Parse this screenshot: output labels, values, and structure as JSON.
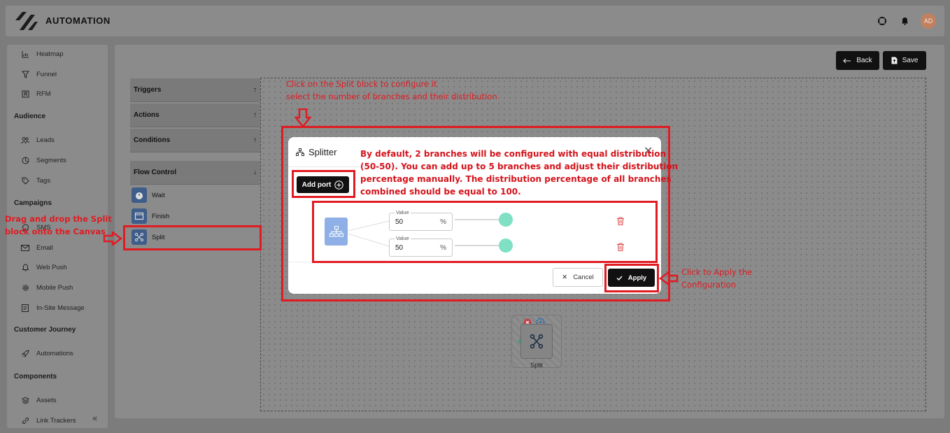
{
  "app": {
    "title": "AUTOMATION",
    "avatar_initials": "AD"
  },
  "sidebar": {
    "sections": [
      {
        "label": "Audience"
      },
      {
        "label": "Campaigns"
      },
      {
        "label": "Customer Journey"
      },
      {
        "label": "Components"
      }
    ],
    "items": [
      {
        "label": "Heatmap",
        "icon": "chart-icon"
      },
      {
        "label": "Funnel",
        "icon": "funnel-icon"
      },
      {
        "label": "RFM",
        "icon": "rfm-icon"
      },
      {
        "label": "Leads",
        "icon": "users-icon"
      },
      {
        "label": "Segments",
        "icon": "pie-icon"
      },
      {
        "label": "Tags",
        "icon": "tag-icon"
      },
      {
        "label": "SMS",
        "icon": "sms-icon"
      },
      {
        "label": "Email",
        "icon": "mail-icon"
      },
      {
        "label": "Web Push",
        "icon": "bell-icon"
      },
      {
        "label": "Mobile Push",
        "icon": "gear-icon"
      },
      {
        "label": "In-Site Message",
        "icon": "message-icon"
      },
      {
        "label": "Automations",
        "icon": "rocket-icon"
      },
      {
        "label": "Assets",
        "icon": "stack-icon"
      },
      {
        "label": "Link Trackers",
        "icon": "link-icon"
      }
    ],
    "collapse_glyph": "«"
  },
  "toolbar": {
    "back_label": "Back",
    "save_label": "Save"
  },
  "palette": {
    "groups": [
      {
        "label": "Triggers",
        "arrow": "↑"
      },
      {
        "label": "Actions",
        "arrow": "↑"
      },
      {
        "label": "Conditions",
        "arrow": "↑"
      },
      {
        "label": "Flow Control",
        "arrow": "↓"
      }
    ],
    "flow_items": [
      {
        "label": "Wait"
      },
      {
        "label": "Finish"
      },
      {
        "label": "Split"
      }
    ]
  },
  "canvas": {
    "node_label": "Split"
  },
  "modal": {
    "title": "Splitter",
    "close_glyph": "✕",
    "add_port_label": "Add port",
    "branches": [
      {
        "field_label": "Value",
        "value": "50",
        "unit": "%",
        "slider_fraction": 1.0
      },
      {
        "field_label": "Value",
        "value": "50",
        "unit": "%",
        "slider_fraction": 1.0
      }
    ],
    "cancel_label": "Cancel",
    "apply_label": "Apply"
  },
  "annotations": {
    "top_line1": "Click on the Split block to configure it",
    "top_line2": "select the number of branches and their distribution",
    "defaults_l1": "By default, 2 branches will be configured with equal distribution",
    "defaults_l2": "(50-50). You can add up to 5 branches and adjust their distribution",
    "defaults_l3": "percentage manually. The distribution percentage of all branches",
    "defaults_l4": "combined should be equal to 100.",
    "drag_l1": "Drag and drop the Split",
    "drag_l2": "block onto the Canvas",
    "apply_l1": "Click to Apply the",
    "apply_l2": "Configuration"
  },
  "colors": {
    "annotation_red": "#e01b22",
    "slider_knob": "#7fe0c4",
    "split_icon_bg": "#8fb0e6"
  }
}
